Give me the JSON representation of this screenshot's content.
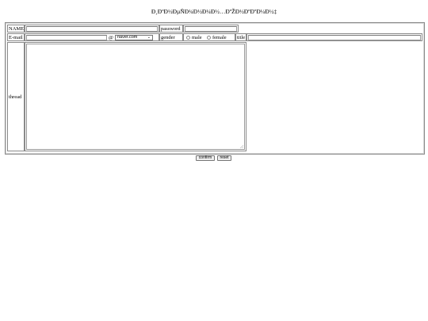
{
  "page": {
    "title": "Ð¸ÐºÐ½ÐµÑÐ¼Ð½Ð¼Ð½…ÐºŽÐ½ÐºÐºÐ¼Ð½‡"
  },
  "form": {
    "name_label": "NAME",
    "name_value": "",
    "password_label": "password",
    "password_value": "",
    "email_label": "E-mail",
    "email_value": "",
    "at_symbol": "@",
    "domain_selected": "naver.com",
    "gender_label": "gender",
    "gender_male": "male",
    "gender_female": "female",
    "title_label": "title",
    "title_value": "",
    "thread_label": "thread",
    "thread_value": ""
  },
  "buttons": {
    "confirm": "confirm",
    "reset": "reset"
  }
}
